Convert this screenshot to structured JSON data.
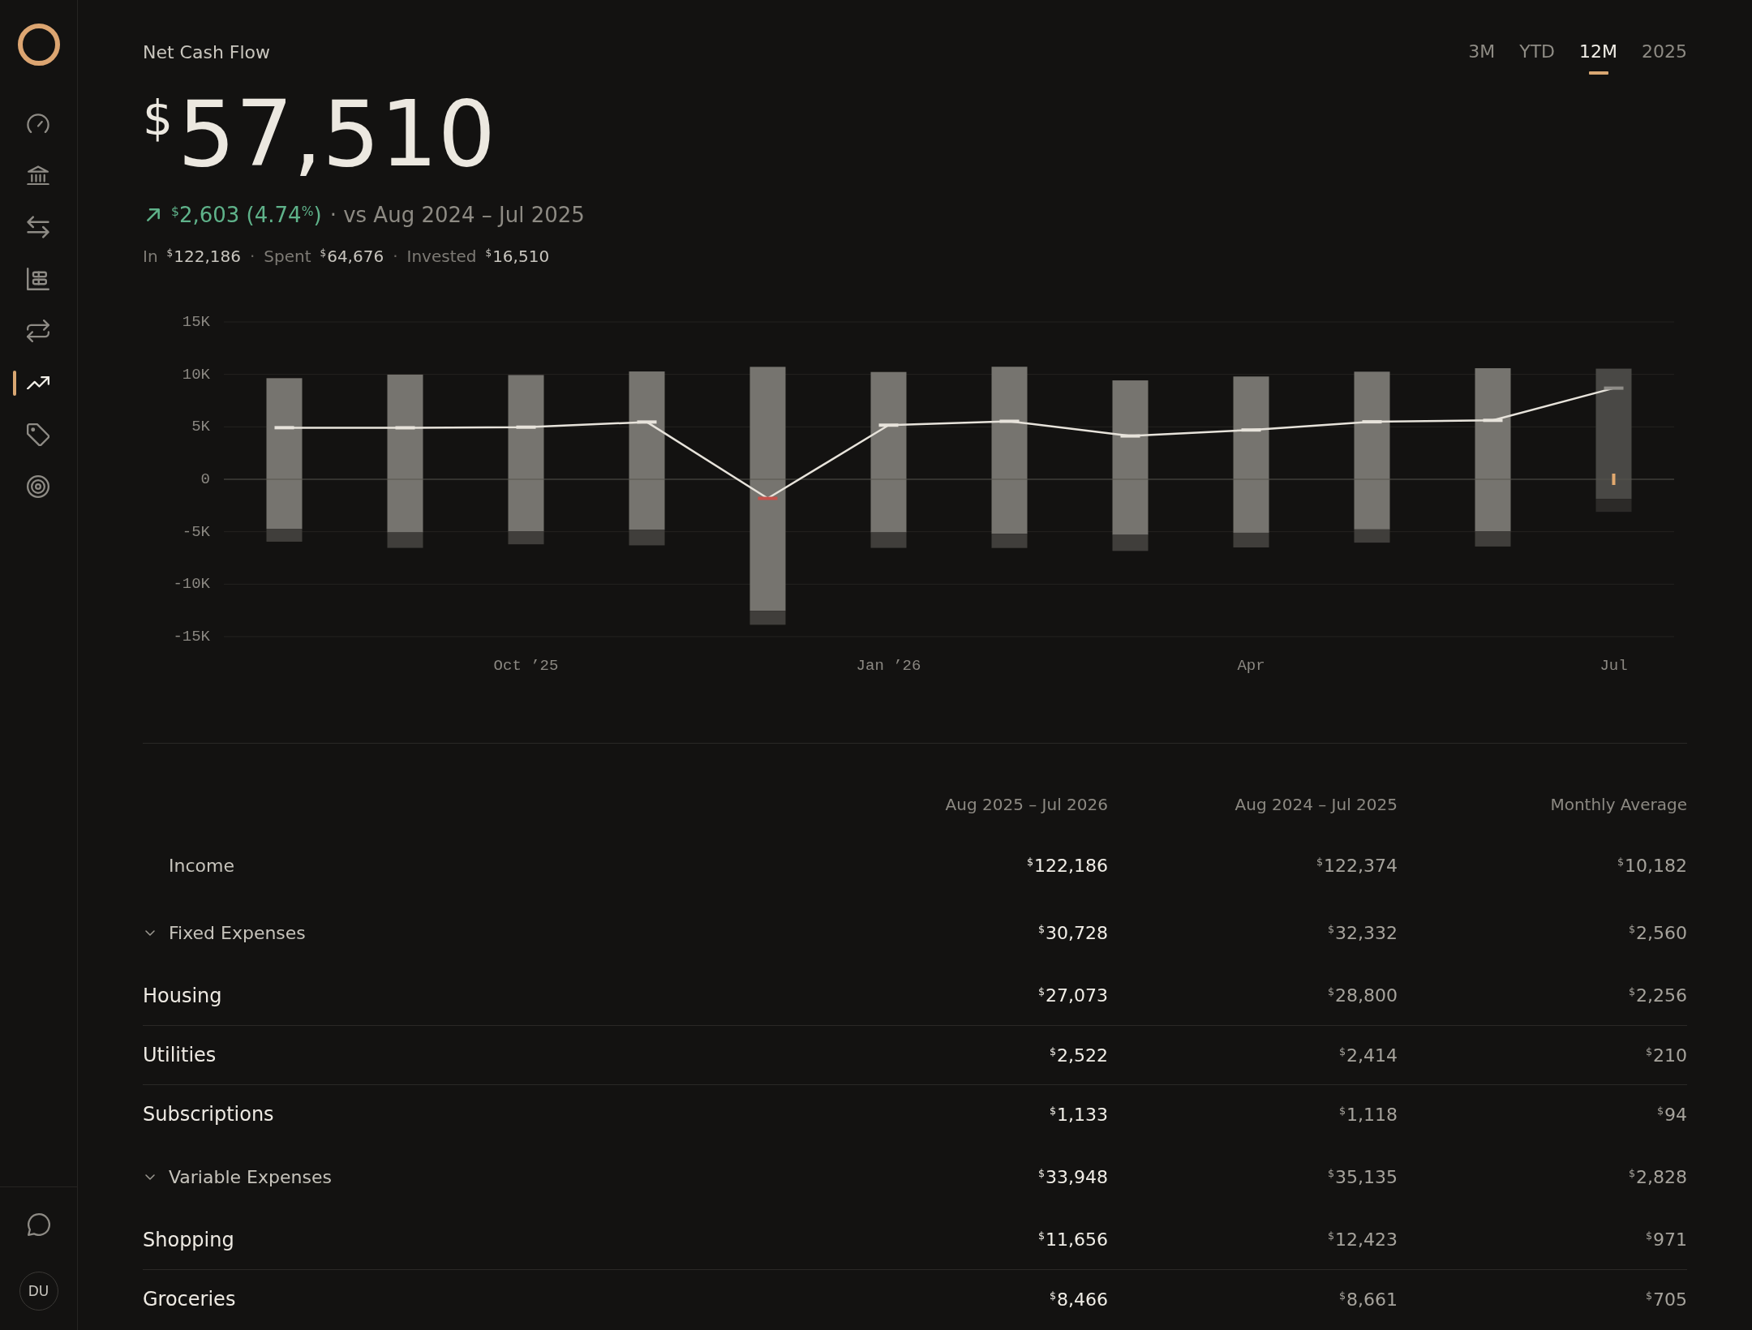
{
  "sidebar": {
    "nav": [
      {
        "selected": false
      },
      {
        "selected": false
      },
      {
        "selected": false
      },
      {
        "selected": false
      },
      {
        "selected": false
      },
      {
        "selected": true
      },
      {
        "selected": false
      },
      {
        "selected": false
      }
    ],
    "avatar": {
      "initials": "DU"
    }
  },
  "header": {
    "title": "Net Cash Flow",
    "amount": "$^{$}$57,510",
    "change": {
      "value": "$^{$}$2,603 (4.74$^{%}$)",
      "comparison": "· vs Aug 2024 – Jul 2025"
    },
    "summary": {
      "items": [
        {
          "label": "In",
          "value": "$^{$}$122,186"
        },
        {
          "separator": "·",
          "label": "Spent",
          "value": "$^{$}$64,676"
        },
        {
          "separator": "·",
          "label": "Invested",
          "value": "$^{$}$16,510"
        }
      ]
    }
  },
  "range_tabs": [
    {
      "label": "3M",
      "selected": false
    },
    {
      "label": "YTD",
      "selected": false
    },
    {
      "label": "12M",
      "selected": true
    },
    {
      "label": "2025",
      "selected": false
    }
  ],
  "chart": {
    "chart_data": {
      "type": "bar",
      "stacked": true,
      "grid": true,
      "categories": [
        null,
        null,
        "Oct ’25",
        null,
        null,
        "Jan ’26",
        null,
        null,
        "Apr",
        null,
        null,
        "Jul"
      ],
      "ylim": [
        -15000,
        15000
      ],
      "yticks": [
        {
          "value": 15000,
          "label": "15K"
        },
        {
          "value": 10000,
          "label": "10K"
        },
        {
          "value": 5000,
          "label": "5K"
        },
        {
          "value": 0,
          "label": "0"
        },
        {
          "value": -5000,
          "label": "-5K"
        },
        {
          "value": -10000,
          "label": "-10K"
        },
        {
          "value": -15000,
          "label": "-15K"
        }
      ],
      "series": [
        {
          "color": "#76746f",
          "values": [
            9640,
            9980,
            9940,
            10280,
            10720,
            10230,
            10730,
            9430,
            9800,
            10260,
            10590,
            null
          ]
        },
        {
          "color": "#76746f",
          "values": [
            -4720,
            -5070,
            -4970,
            -4820,
            -12540,
            -5070,
            -5200,
            -5300,
            -5100,
            -4780,
            -4970,
            null
          ]
        },
        {
          "color": "#403e3b",
          "values": [
            -1230,
            -1470,
            -1230,
            -1480,
            -1330,
            -1470,
            -1350,
            -1530,
            -1400,
            -1260,
            -1440,
            null
          ]
        },
        {
          "color": "#494845",
          "values": [
            null,
            null,
            null,
            null,
            null,
            null,
            null,
            null,
            null,
            null,
            null,
            10550
          ]
        },
        {
          "color": "#494845",
          "values": [
            null,
            null,
            null,
            null,
            null,
            null,
            null,
            null,
            null,
            null,
            null,
            -1860
          ]
        },
        {
          "color": "#2c2a28",
          "values": [
            null,
            null,
            null,
            null,
            null,
            null,
            null,
            null,
            null,
            null,
            null,
            -1250
          ]
        },
        {
          "type": "line",
          "color": "#e7e3db",
          "values": [
            4920,
            4910,
            4970,
            5460,
            -1820,
            5160,
            5530,
            4130,
            4700,
            5480,
            5620,
            8690
          ]
        }
      ],
      "annotations": [
        {
          "x": "Jul"
        }
      ]
    }
  },
  "table": {
    "columns": [
      "Aug 2025 – Jul 2026",
      "Aug 2024 – Jul 2025",
      "Monthly Average"
    ],
    "rows": [
      {
        "kind": "summary",
        "label": "Income",
        "values": [
          "$^{$}$122,186",
          "$^{$}$122,374",
          "$^{$}$10,182"
        ]
      },
      {
        "kind": "group",
        "label": "Fixed Expenses",
        "expanded": true,
        "values": [
          "$^{$}$30,728",
          "$^{$}$32,332",
          "$^{$}$2,560"
        ],
        "children": [
          {
            "label": "Housing",
            "values": [
              "$^{$}$27,073",
              "$^{$}$28,800",
              "$^{$}$2,256"
            ]
          },
          {
            "label": "Utilities",
            "values": [
              "$^{$}$2,522",
              "$^{$}$2,414",
              "$^{$}$210"
            ]
          },
          {
            "label": "Subscriptions",
            "values": [
              "$^{$}$1,133",
              "$^{$}$1,118",
              "$^{$}$94"
            ]
          }
        ]
      },
      {
        "kind": "group",
        "label": "Variable Expenses",
        "expanded": true,
        "values": [
          "$^{$}$33,948",
          "$^{$}$35,135",
          "$^{$}$2,828"
        ],
        "children": [
          {
            "label": "Shopping",
            "values": [
              "$^{$}$11,656",
              "$^{$}$12,423",
              "$^{$}$971"
            ]
          },
          {
            "label": "Groceries",
            "values": [
              "$^{$}$8,466",
              "$^{$}$8,661",
              "$^{$}$705"
            ]
          }
        ]
      }
    ]
  }
}
